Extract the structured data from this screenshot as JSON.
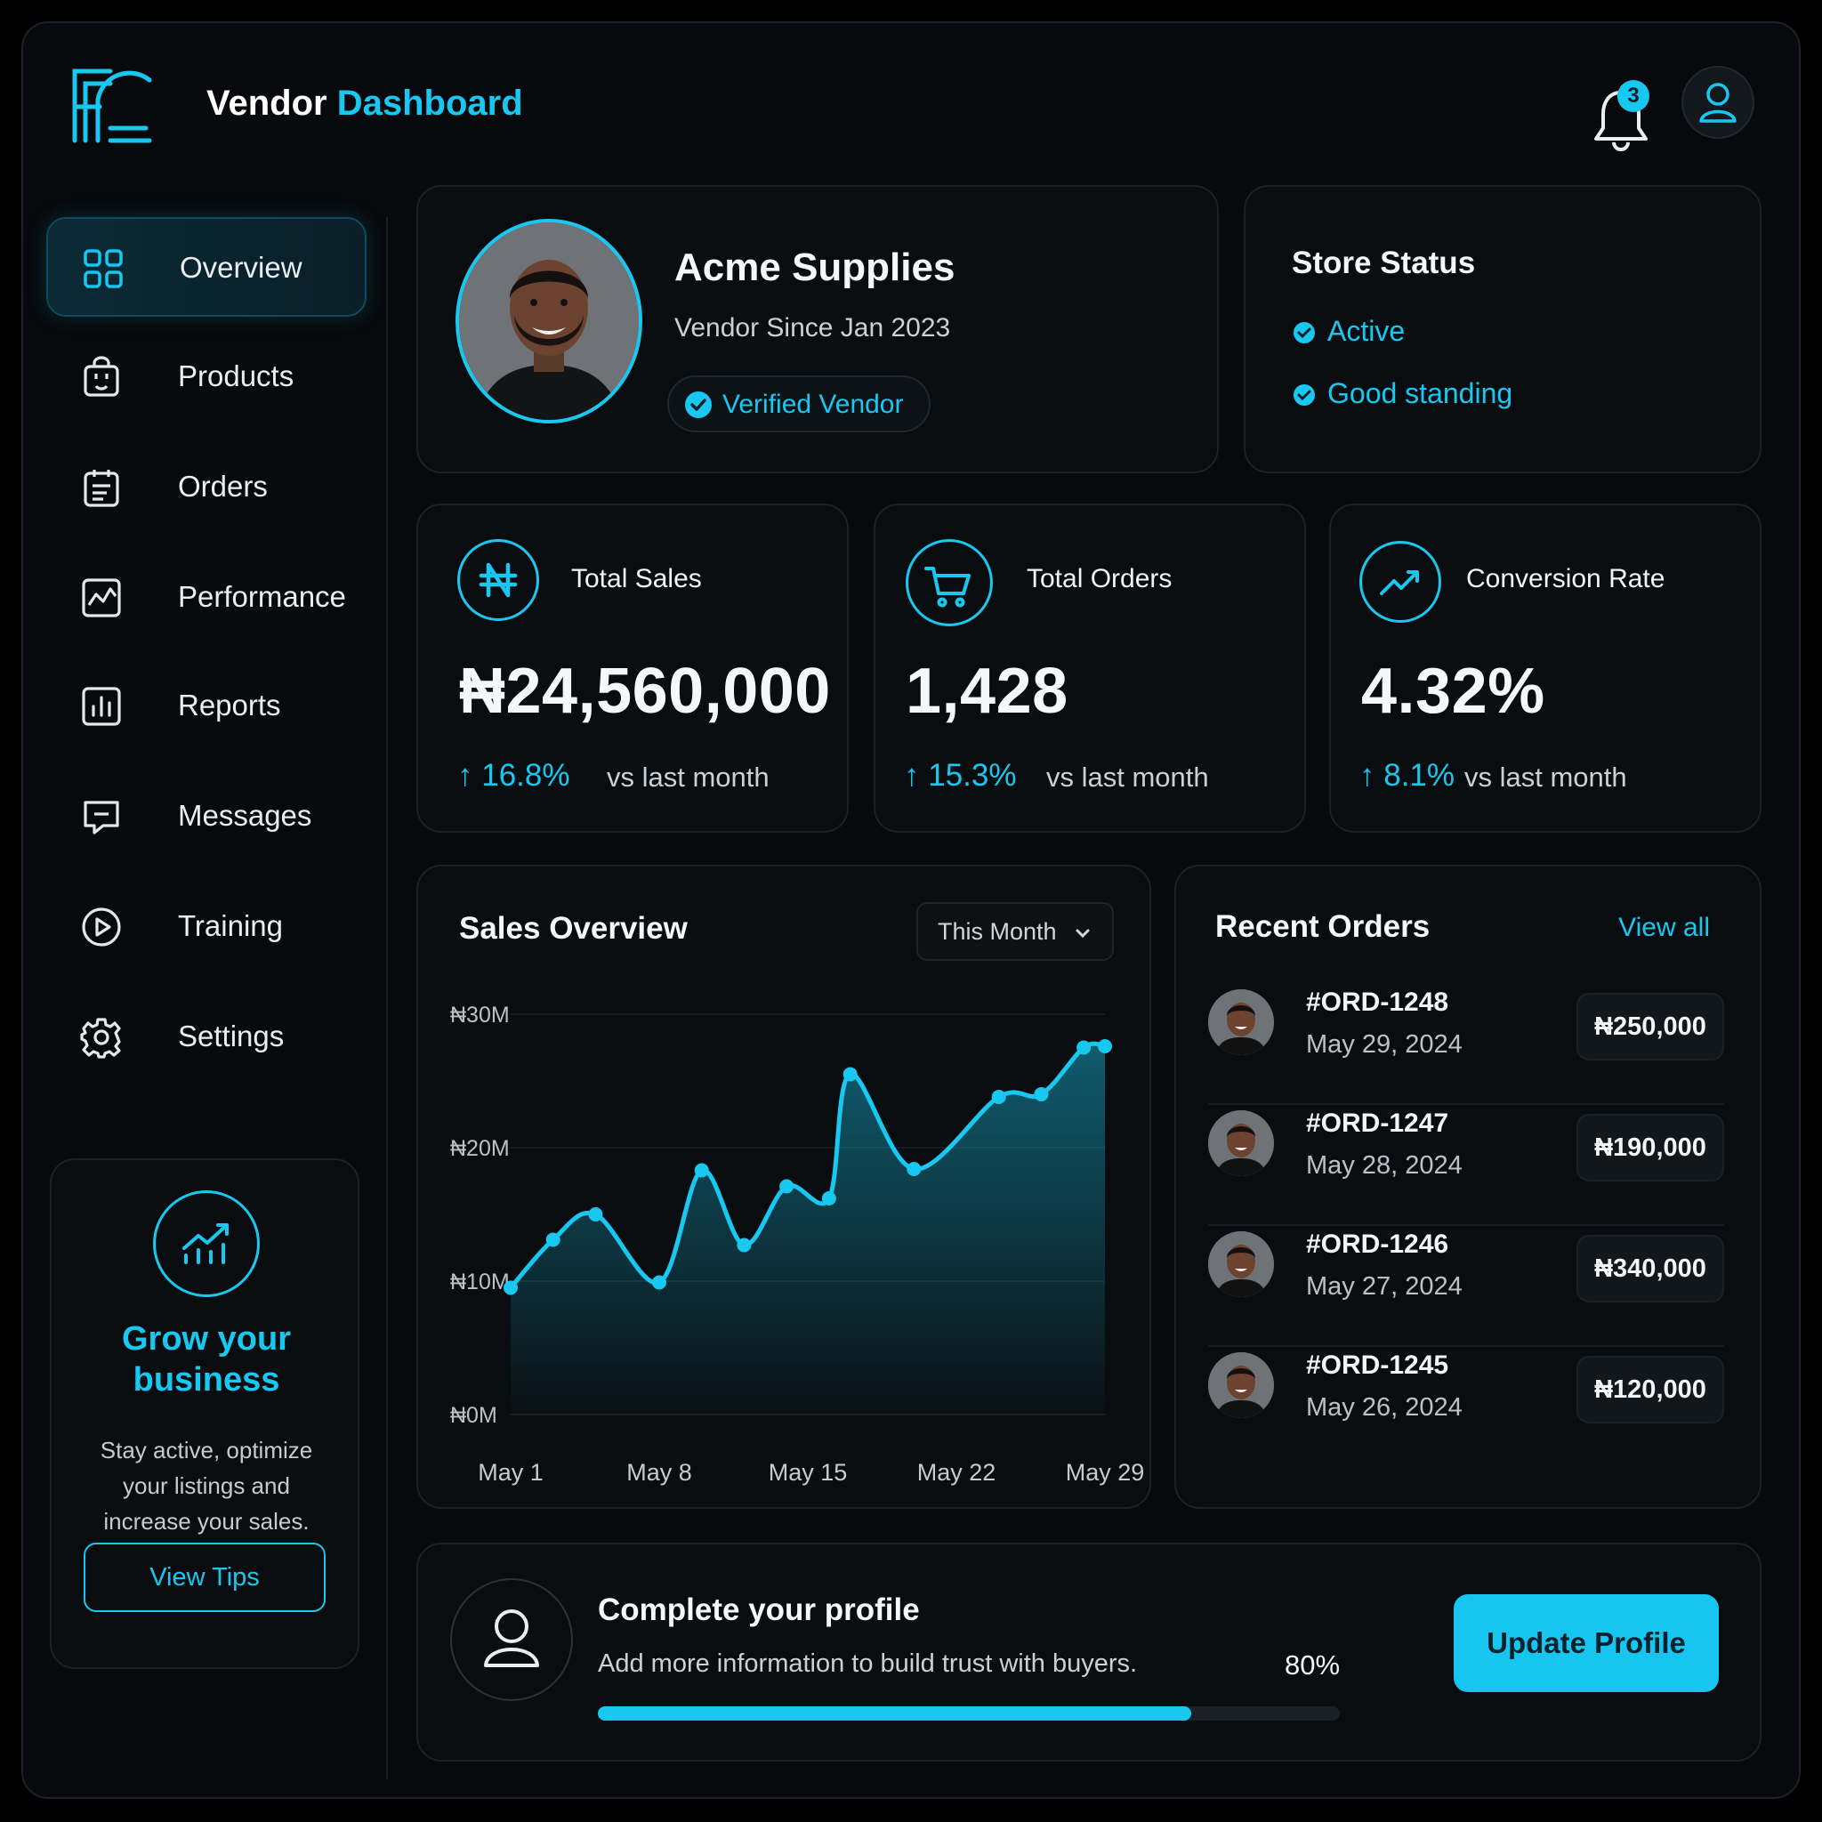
{
  "header": {
    "logo_text": "FC",
    "title_white": "Vendor",
    "title_cyan": "Dashboard",
    "notification_count": "3"
  },
  "sidebar": {
    "items": [
      {
        "label": "Overview",
        "icon": "grid-icon",
        "active": true
      },
      {
        "label": "Products",
        "icon": "shopping-bag-icon"
      },
      {
        "label": "Orders",
        "icon": "clipboard-icon"
      },
      {
        "label": "Performance",
        "icon": "line-chart-icon"
      },
      {
        "label": "Reports",
        "icon": "bar-chart-icon"
      },
      {
        "label": "Messages",
        "icon": "message-icon"
      },
      {
        "label": "Training",
        "icon": "play-circle-icon"
      },
      {
        "label": "Settings",
        "icon": "gear-icon"
      }
    ],
    "promo": {
      "title": "Grow your business",
      "text": "Stay active, optimize your listings and increase your sales.",
      "button": "View Tips"
    }
  },
  "profile": {
    "name": "Acme Supplies",
    "since": "Vendor Since Jan 2023",
    "badge": "Verified Vendor"
  },
  "store_status": {
    "title": "Store Status",
    "items": [
      "Active",
      "Good standing"
    ]
  },
  "stats": [
    {
      "title": "Total Sales",
      "value": "₦24,560,000",
      "delta": "16.8%",
      "vs": "vs last month",
      "icon": "naira-icon"
    },
    {
      "title": "Total Orders",
      "value": "1,428",
      "delta": "15.3%",
      "vs": "vs last month",
      "icon": "cart-icon"
    },
    {
      "title": "Conversion Rate",
      "value": "4.32%",
      "delta": "8.1%",
      "vs": "vs last month",
      "icon": "trend-up-icon"
    }
  ],
  "sales_overview": {
    "title": "Sales Overview",
    "range": "This Month"
  },
  "chart_data": {
    "type": "area",
    "title": "Sales Overview",
    "x_tick_labels": [
      "May 1",
      "May 8",
      "May 15",
      "May 22",
      "May 29"
    ],
    "y_tick_labels": [
      "₦30M",
      "₦20M",
      "₦10M",
      "₦0M"
    ],
    "ylim": [
      0,
      30
    ],
    "y_unit": "₦M",
    "series": [
      {
        "day": [
          1,
          3,
          5,
          8,
          10,
          12,
          14,
          16,
          17,
          20,
          24,
          26,
          28,
          29
        ],
        "values": [
          9.5,
          13.1,
          15.0,
          9.9,
          18.3,
          12.7,
          17.1,
          16.2,
          25.5,
          18.4,
          23.8,
          24.0,
          27.5,
          27.6
        ]
      }
    ],
    "grid": true,
    "accent_color": "#18c8f0"
  },
  "recent_orders": {
    "title": "Recent Orders",
    "view_all": "View all",
    "rows": [
      {
        "id": "#ORD-1248",
        "date": "May 29, 2024",
        "amount": "₦250,000"
      },
      {
        "id": "#ORD-1247",
        "date": "May 28, 2024",
        "amount": "₦190,000"
      },
      {
        "id": "#ORD-1246",
        "date": "May 27, 2024",
        "amount": "₦340,000"
      },
      {
        "id": "#ORD-1245",
        "date": "May 26, 2024",
        "amount": "₦120,000"
      }
    ]
  },
  "complete_profile": {
    "title": "Complete your profile",
    "text": "Add more information to build trust with buyers.",
    "percent": "80%",
    "progress": 0.8,
    "button": "Update Profile"
  },
  "colors": {
    "accent": "#18c8f0",
    "background": "#07090c",
    "card": "#0a0d10"
  }
}
